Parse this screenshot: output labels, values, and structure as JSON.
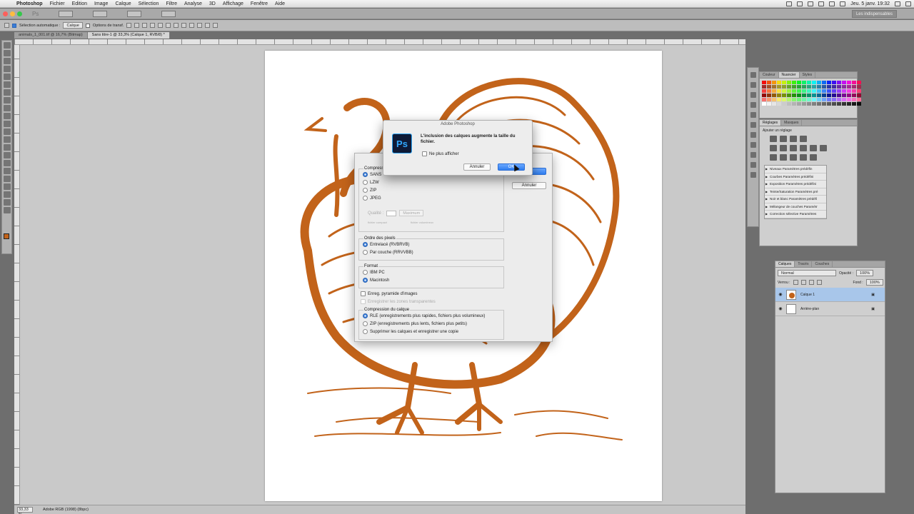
{
  "menubar": {
    "app": "Photoshop",
    "items": [
      "Fichier",
      "Edition",
      "Image",
      "Calque",
      "Sélection",
      "Filtre",
      "Analyse",
      "3D",
      "Affichage",
      "Fenêtre",
      "Aide"
    ],
    "clock": "Jeu. 5 janv.  19:32"
  },
  "appbar": {
    "logo": "Ps",
    "workspace": "Les indispensables"
  },
  "optbar": {
    "auto_select": "Sélection automatique :",
    "auto_select_value": "Calque",
    "transform": "Options de transf."
  },
  "tabs": [
    "animals_1_001.tif @ 16,7% (Bitmap)",
    "Sans titre-1 @ 33,3% (Calque 1, RVB/8) *"
  ],
  "statusbar": {
    "zoom": "33,33 %",
    "profile": "Adobe RGB (1998) (8bpc)"
  },
  "colors": {
    "turkey": "#c2631a",
    "accent_blue": "#3a7dd8",
    "canvas_bg": "#c9c9c9"
  },
  "panels": {
    "swatch_tabs": [
      "Couleur",
      "Nuancier",
      "Styles"
    ],
    "adjust_tabs": [
      "Réglages",
      "Masques"
    ],
    "adjust_title": "Ajouter un réglage",
    "presets": [
      "Niveaux Paramètres prédéfin",
      "Courbes Paramètres prédéfini",
      "Exposition Paramètres prédéfini",
      "Teinte/Saturation Paramètres pré",
      "Noir et blanc Paramètres prédéfi",
      "Mélangeur de couches Paramètr",
      "Correction sélective Paramètres"
    ],
    "layers_tabs": [
      "Calques",
      "Tracés",
      "Couches"
    ],
    "blend_mode": "Normal",
    "opacity_label": "Opacité :",
    "opacity_value": "100%",
    "lock_label": "Verrou :",
    "fill_label": "Fond :",
    "fill_value": "100%",
    "layers": [
      "Calque 1",
      "Arrière-plan"
    ]
  },
  "tiff_dialog": {
    "compression_label": "Compression de l'image",
    "compression_options": [
      "SANS",
      "LZW",
      "ZIP",
      "JPEG"
    ],
    "quality_label": "Qualité :",
    "quality_select": "Maximum",
    "small_file": "fichier compact",
    "large_file": "fichier volumineux",
    "pixel_order_label": "Ordre des pixels",
    "pixel_order_options": [
      "Entrelacé (RVBRVB)",
      "Par couche (RRVVBB)"
    ],
    "format_label": "Format",
    "format_options": [
      "IBM PC",
      "Macintosh"
    ],
    "pyramid": "Enreg. pyramide d'images",
    "transparency": "Enregistrer les zones transparentes",
    "layer_comp_label": "Compression du calque",
    "layer_comp_options": [
      "RLE (enregistrements plus rapides, fichiers plus volumineux)",
      "ZIP (enregistrements plus lents, fichiers plus petits)",
      "Supprimer les calques et enregistrer une copie"
    ],
    "ok": "OK",
    "cancel": "Annuler"
  },
  "alert": {
    "title": "Adobe Photoshop",
    "icon": "Ps",
    "message": "L'inclusion des calques augmente la taille du fichier.",
    "dont_show": "Ne plus afficher",
    "cancel": "Annuler",
    "ok": "OK"
  }
}
